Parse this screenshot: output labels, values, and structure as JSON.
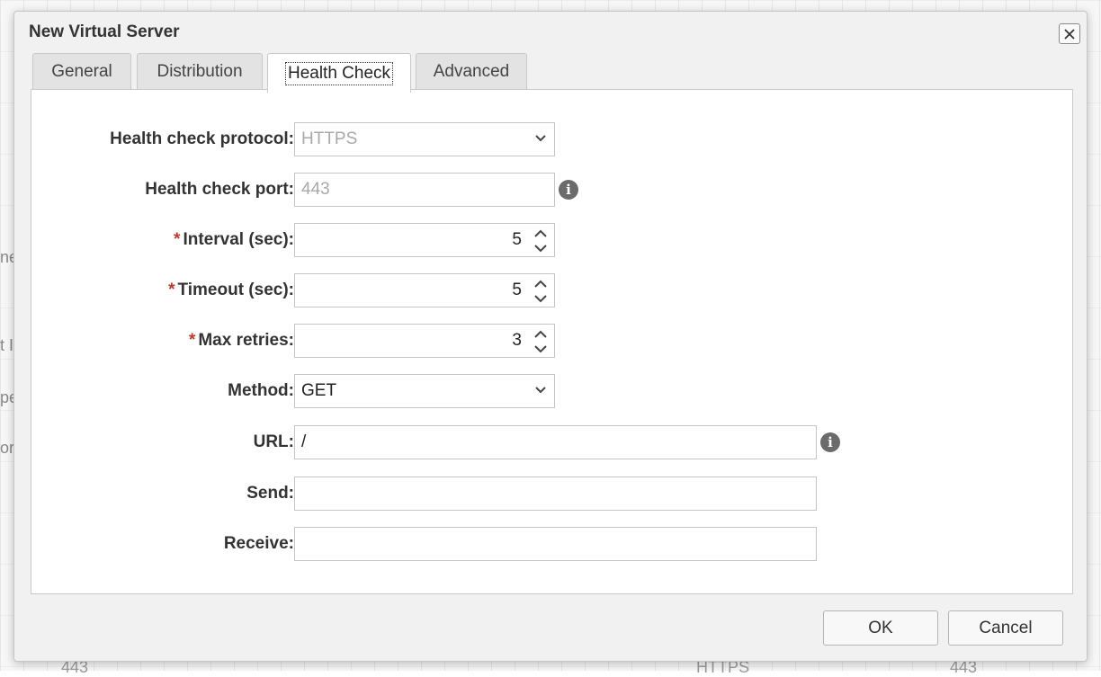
{
  "background": {
    "left_fragments": [
      "ne",
      "t II",
      "pe",
      "or"
    ],
    "bottom_values": [
      "443",
      "HTTPS",
      "443"
    ]
  },
  "dialog": {
    "title": "New Virtual Server",
    "tabs": [
      {
        "label": "General",
        "active": false
      },
      {
        "label": "Distribution",
        "active": false
      },
      {
        "label": "Health Check",
        "active": true
      },
      {
        "label": "Advanced",
        "active": false
      }
    ],
    "form": {
      "protocol": {
        "label": "Health check protocol:",
        "value": "HTTPS",
        "disabled": true
      },
      "port": {
        "label": "Health check port:",
        "placeholder": "443",
        "disabled": true
      },
      "interval": {
        "label": "Interval (sec):",
        "value": "5",
        "required": true
      },
      "timeout": {
        "label": "Timeout (sec):",
        "value": "5",
        "required": true
      },
      "max_retries": {
        "label": "Max retries:",
        "value": "3",
        "required": true
      },
      "method": {
        "label": "Method:",
        "value": "GET"
      },
      "url": {
        "label": "URL:",
        "value": "/"
      },
      "send": {
        "label": "Send:",
        "value": ""
      },
      "receive": {
        "label": "Receive:",
        "value": ""
      },
      "required_marker": "*"
    },
    "buttons": {
      "ok": "OK",
      "cancel": "Cancel"
    },
    "icons": {
      "info": "i",
      "close": "close-icon"
    }
  },
  "colors": {
    "required": "#c0392b",
    "info_icon": "#6b6b6b"
  }
}
